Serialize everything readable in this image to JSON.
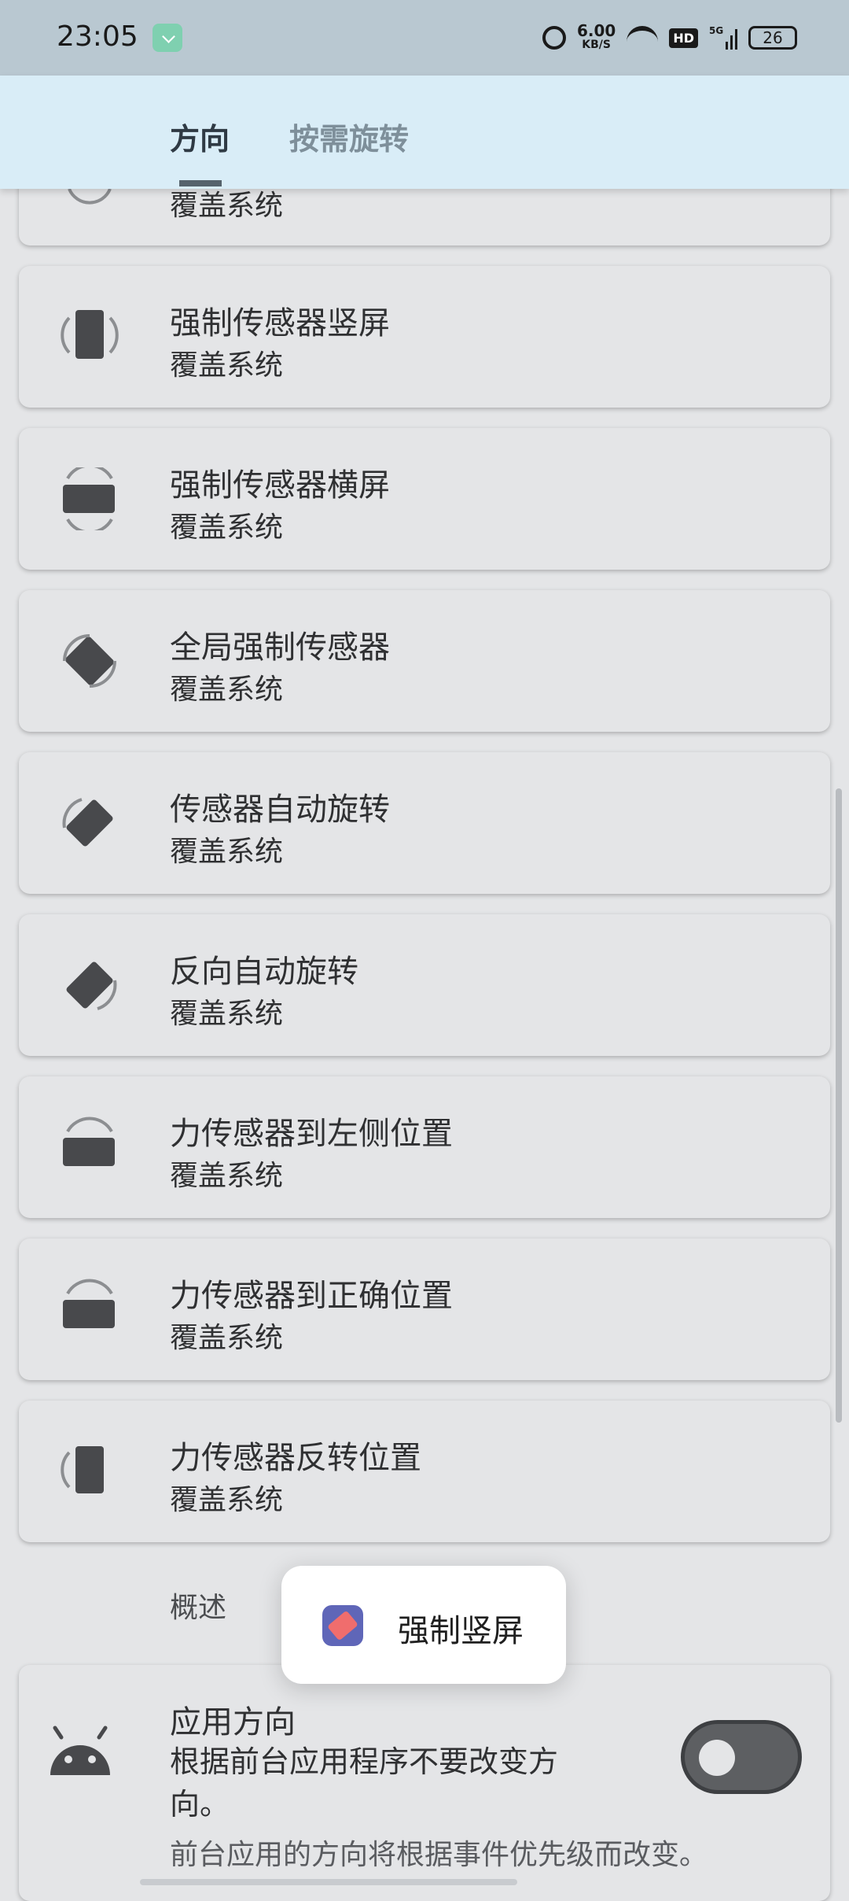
{
  "status_bar": {
    "time": "23:05",
    "net_speed_value": "6.00",
    "net_speed_unit": "KB/S",
    "hd_label": "HD",
    "network_label": "5G",
    "battery": "26"
  },
  "tabs": [
    {
      "label": "方向",
      "selected": true
    },
    {
      "label": "按需旋转",
      "selected": false
    }
  ],
  "top_card": {
    "subtitle": "覆盖系统"
  },
  "cards": [
    {
      "title": "强制传感器竖屏",
      "subtitle": "覆盖系统",
      "icon": "sensor-portrait-icon"
    },
    {
      "title": "强制传感器横屏",
      "subtitle": "覆盖系统",
      "icon": "sensor-landscape-icon"
    },
    {
      "title": "全局强制传感器",
      "subtitle": "覆盖系统",
      "icon": "full-sensor-icon"
    },
    {
      "title": "传感器自动旋转",
      "subtitle": "覆盖系统",
      "icon": "auto-rotate-icon"
    },
    {
      "title": "反向自动旋转",
      "subtitle": "覆盖系统",
      "icon": "reverse-rotate-icon"
    },
    {
      "title": "力传感器到左侧位置",
      "subtitle": "覆盖系统",
      "icon": "landscape-left-icon"
    },
    {
      "title": "力传感器到正确位置",
      "subtitle": "覆盖系统",
      "icon": "landscape-right-icon"
    },
    {
      "title": "力传感器反转位置",
      "subtitle": "覆盖系统",
      "icon": "reverse-portrait-icon"
    }
  ],
  "section": {
    "title": "概述"
  },
  "toast": {
    "text": "强制竖屏",
    "icon": "rotate-app-icon"
  },
  "app_orientation": {
    "title": "应用方向",
    "subtitle": "根据前台应用程序不要改变方向。",
    "description": "前台应用的方向将根据事件优先级而改变。",
    "toggle_on": false
  }
}
